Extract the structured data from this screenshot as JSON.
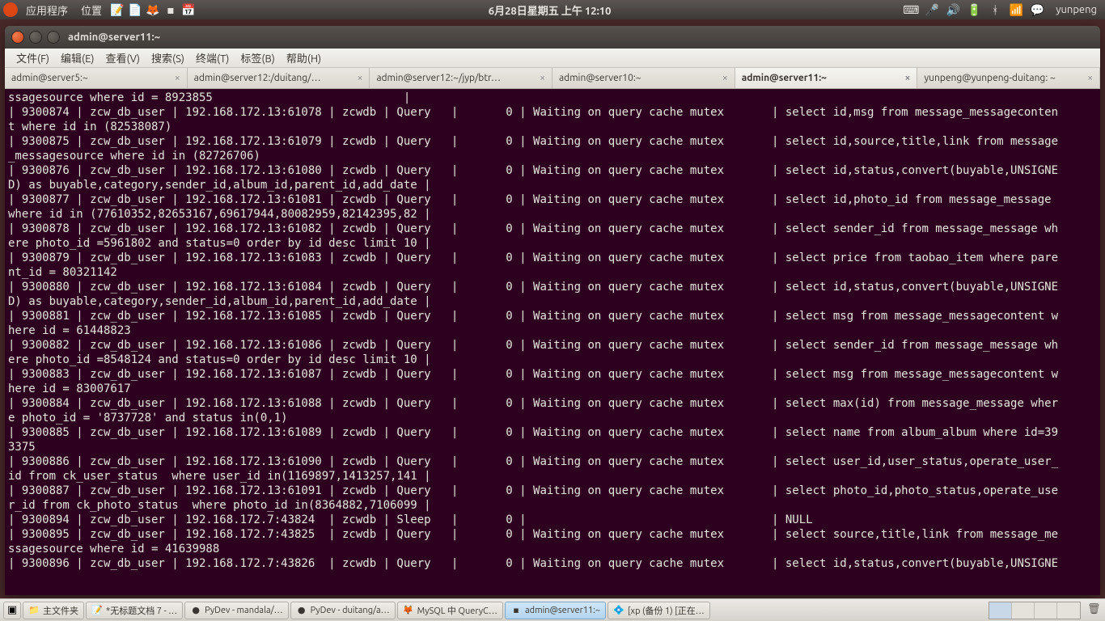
{
  "top_panel": {
    "apps": "应用程序",
    "places": "位置",
    "datetime": "6月28日星期五 上午 12:10",
    "user": "yunpeng"
  },
  "window": {
    "title": "admin@server11:~"
  },
  "menubar": {
    "file": "文件(F)",
    "edit": "编辑(E)",
    "view": "查看(V)",
    "search": "搜索(S)",
    "terminal": "终端(T)",
    "tabs": "标签(B)",
    "help": "帮助(H)"
  },
  "tabs": [
    {
      "label": "admin@server5:~"
    },
    {
      "label": "admin@server12:/duitang/…"
    },
    {
      "label": "admin@server12:~/jyp/btr…"
    },
    {
      "label": "admin@server10:~"
    },
    {
      "label": "admin@server11:~",
      "active": true
    },
    {
      "label": "yunpeng@yunpeng-duitang: ~"
    }
  ],
  "terminal_lines": [
    "ssagesource where id = 8923855                            |",
    "| 9300874 | zcw_db_user | 192.168.172.13:61078 | zcwdb | Query   |       0 | Waiting on query cache mutex       | select id,msg from message_messageconten",
    "t where id in (82538087)",
    "| 9300875 | zcw_db_user | 192.168.172.13:61079 | zcwdb | Query   |       0 | Waiting on query cache mutex       | select id,source,title,link from message",
    "_messagesource where id in (82726706)",
    "| 9300876 | zcw_db_user | 192.168.172.13:61080 | zcwdb | Query   |       0 | Waiting on query cache mutex       | select id,status,convert(buyable,UNSIGNE",
    "D) as buyable,category,sender_id,album_id,parent_id,add_date |",
    "| 9300877 | zcw_db_user | 192.168.172.13:61081 | zcwdb | Query   |       0 | Waiting on query cache mutex       | select id,photo_id from message_message ",
    "where id in (77610352,82653167,69617944,80082959,82142395,82 |",
    "| 9300878 | zcw_db_user | 192.168.172.13:61082 | zcwdb | Query   |       0 | Waiting on query cache mutex       | select sender_id from message_message wh",
    "ere photo_id =5961802 and status=0 order by id desc limit 10 |",
    "| 9300879 | zcw_db_user | 192.168.172.13:61083 | zcwdb | Query   |       0 | Waiting on query cache mutex       | select price from taobao_item where pare",
    "nt_id = 80321142",
    "| 9300880 | zcw_db_user | 192.168.172.13:61084 | zcwdb | Query   |       0 | Waiting on query cache mutex       | select id,status,convert(buyable,UNSIGNE",
    "D) as buyable,category,sender_id,album_id,parent_id,add_date |",
    "| 9300881 | zcw_db_user | 192.168.172.13:61085 | zcwdb | Query   |       0 | Waiting on query cache mutex       | select msg from message_messagecontent w",
    "here id = 61448823",
    "| 9300882 | zcw_db_user | 192.168.172.13:61086 | zcwdb | Query   |       0 | Waiting on query cache mutex       | select sender_id from message_message wh",
    "ere photo_id =8548124 and status=0 order by id desc limit 10 |",
    "| 9300883 | zcw_db_user | 192.168.172.13:61087 | zcwdb | Query   |       0 | Waiting on query cache mutex       | select msg from message_messagecontent w",
    "here id = 83007617",
    "| 9300884 | zcw_db_user | 192.168.172.13:61088 | zcwdb | Query   |       0 | Waiting on query cache mutex       | select max(id) from message_message wher",
    "e photo_id = '8737728' and status in(0,1)",
    "| 9300885 | zcw_db_user | 192.168.172.13:61089 | zcwdb | Query   |       0 | Waiting on query cache mutex       | select name from album_album where id=39",
    "3375",
    "| 9300886 | zcw_db_user | 192.168.172.13:61090 | zcwdb | Query   |       0 | Waiting on query cache mutex       | select user_id,user_status,operate_user_",
    "id from ck_user_status  where user_id in(1169897,1413257,141 |",
    "| 9300887 | zcw_db_user | 192.168.172.13:61091 | zcwdb | Query   |       0 | Waiting on query cache mutex       | select photo_id,photo_status,operate_use",
    "r_id from ck_photo_status  where photo_id in(8364882,7106099 |",
    "| 9300894 | zcw_db_user | 192.168.172.7:43824  | zcwdb | Sleep   |       0 |                                    | NULL",
    "",
    "| 9300895 | zcw_db_user | 192.168.172.7:43825  | zcwdb | Query   |       0 | Waiting on query cache mutex       | select source,title,link from message_me",
    "ssagesource where id = 41639988",
    "| 9300896 | zcw_db_user | 192.168.172.7:43826  | zcwdb | Query   |       0 | Waiting on query cache mutex       | select id,status,convert(buyable,UNSIGNE"
  ],
  "taskbar": [
    {
      "label": "主文件夹",
      "icon": "📁"
    },
    {
      "label": "*无标题文档 7 - …",
      "icon": "📝"
    },
    {
      "label": "PyDev - mandala/…",
      "icon": "●"
    },
    {
      "label": "PyDev - duitang/a…",
      "icon": "●"
    },
    {
      "label": "MySQL 中 QueryC…",
      "icon": "🦊"
    },
    {
      "label": "admin@server11:~",
      "icon": "▪",
      "active": true
    },
    {
      "label": "[xp (备份 1) [正在…",
      "icon": "💠"
    }
  ]
}
